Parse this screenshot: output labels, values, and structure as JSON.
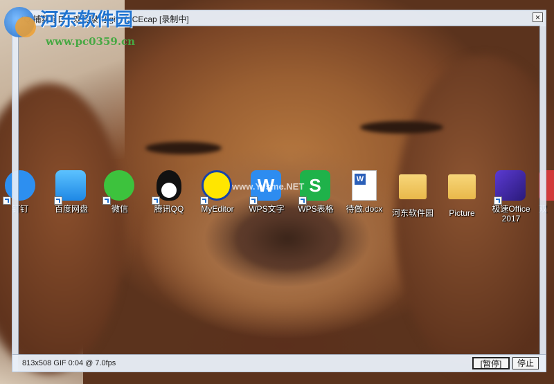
{
  "window": {
    "title": "*Q 捕获窗口 - 欢迎录制 gif - LICEcap [录制中]",
    "close_label": "×"
  },
  "watermark": {
    "title": "河东软件园",
    "url": "www.pc0359.cn"
  },
  "desktop": {
    "icons": [
      {
        "label": "钉钉",
        "icon": "dingtalk-icon"
      },
      {
        "label": "百度网盘",
        "icon": "baidu-netdisk-icon"
      },
      {
        "label": "微信",
        "icon": "wechat-icon"
      },
      {
        "label": "腾讯QQ",
        "icon": "qq-icon"
      },
      {
        "label": "MyEditor",
        "icon": "myeditor-icon"
      },
      {
        "label": "WPS文字",
        "icon": "wps-writer-icon"
      },
      {
        "label": "WPS表格",
        "icon": "wps-spreadsheet-icon"
      },
      {
        "label": "待做.docx",
        "icon": "docx-file-icon"
      },
      {
        "label": "河东软件园",
        "icon": "folder-icon"
      },
      {
        "label": "Picture",
        "icon": "folder-icon"
      },
      {
        "label": "极速Office 2017",
        "icon": "office-icon"
      },
      {
        "label": "双",
        "icon": "app-icon"
      }
    ],
    "overlay_text": "www.Yvsme.NET"
  },
  "statusbar": {
    "info": "813x508 GIF 0:04 @ 7.0fps",
    "pause_label": "[暂停]",
    "stop_label": "停止"
  }
}
